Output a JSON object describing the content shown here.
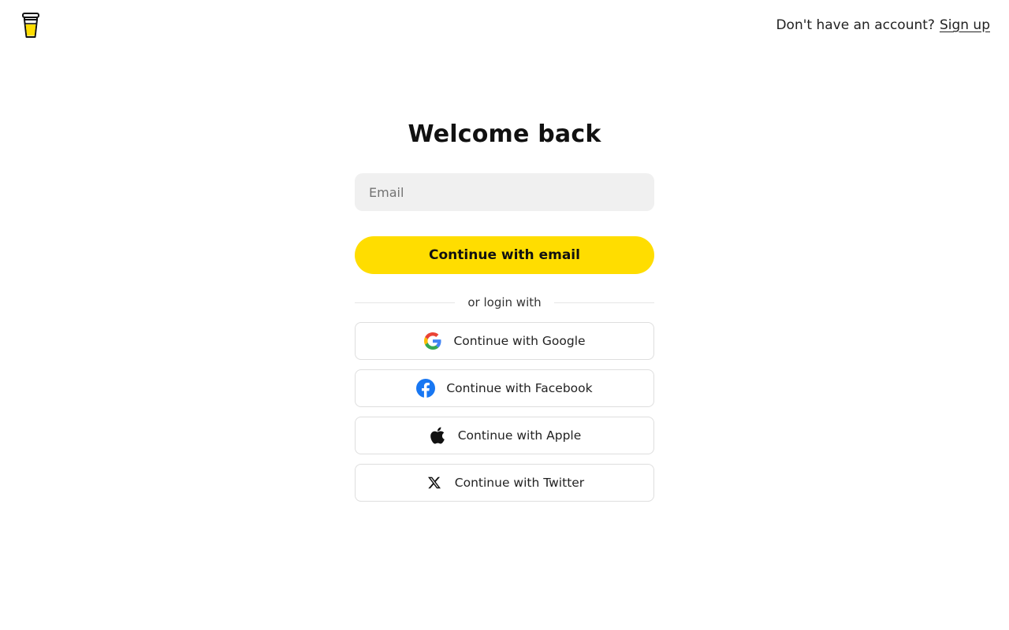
{
  "header": {
    "logo_icon": "coffee-cup-icon",
    "prompt_text": "Don't have an account?",
    "signup_label": "Sign up"
  },
  "main": {
    "title": "Welcome back",
    "email_placeholder": "Email",
    "email_value": "",
    "continue_email_label": "Continue with email",
    "divider_text": "or login with",
    "social": [
      {
        "label": "Continue with Google",
        "icon": "google-icon"
      },
      {
        "label": "Continue with Facebook",
        "icon": "facebook-icon"
      },
      {
        "label": "Continue with Apple",
        "icon": "apple-icon"
      },
      {
        "label": "Continue with Twitter",
        "icon": "x-icon"
      }
    ]
  },
  "colors": {
    "accent": "#FFDD00",
    "input_bg": "#F0F0F0",
    "text": "#111111",
    "border": "#DEDEDE",
    "facebook_blue": "#1877F2"
  }
}
